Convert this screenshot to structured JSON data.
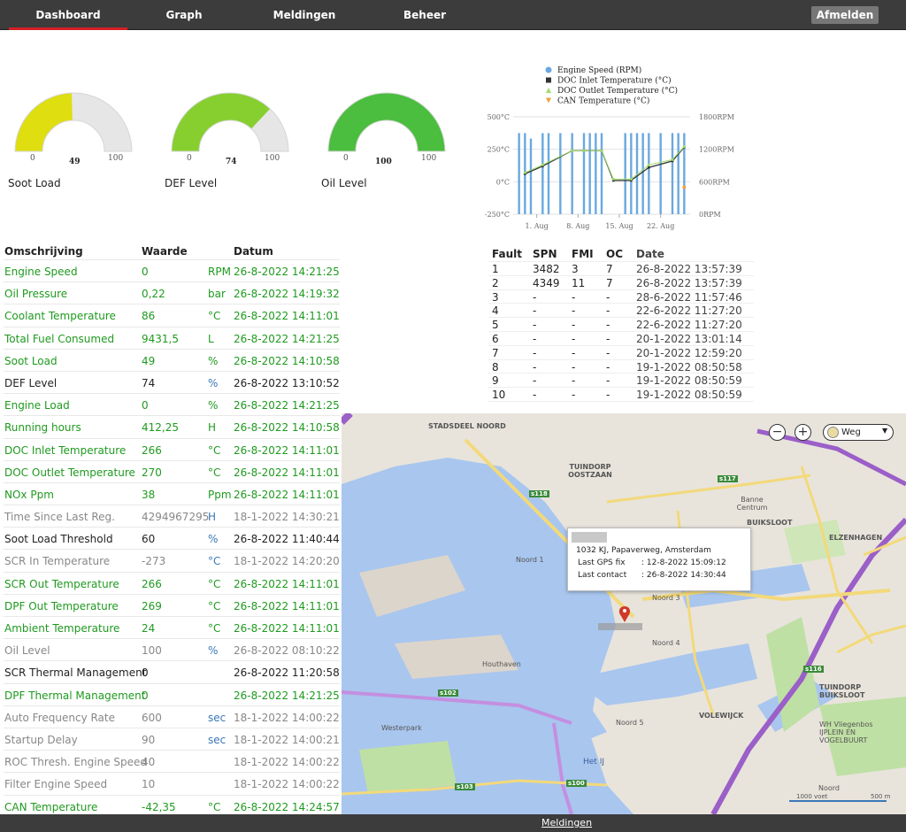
{
  "nav": {
    "tabs": [
      {
        "label": "Dashboard",
        "active": true
      },
      {
        "label": "Graph",
        "active": false
      },
      {
        "label": "Meldingen",
        "active": false
      },
      {
        "label": "Beheer",
        "active": false
      }
    ],
    "logout_label": "Afmelden"
  },
  "gauges": [
    {
      "label": "Soot Load",
      "value": 49,
      "min": 0,
      "max": 100,
      "color": "#dede10"
    },
    {
      "label": "DEF Level",
      "value": 74,
      "min": 0,
      "max": 100,
      "color": "#86cf2e"
    },
    {
      "label": "Oil Level",
      "value": 100,
      "min": 0,
      "max": 100,
      "color": "#4bbd3f"
    }
  ],
  "chart_data": {
    "type": "line",
    "legend": [
      "Engine Speed (RPM)",
      "DOC Inlet Temperature (°C)",
      "DOC Outlet Temperature (°C)",
      "CAN Temperature (°C)"
    ],
    "legend_colors": [
      "#6aa8e0",
      "#333333",
      "#9edc6a",
      "#f2a13a"
    ],
    "y_left_ticks": [
      "500°C",
      "250°C",
      "0°C",
      "-250°C"
    ],
    "y_right_ticks": [
      "1800RPM",
      "1200RPM",
      "600RPM",
      "0RPM"
    ],
    "x_ticks": [
      "1. Aug",
      "8. Aug",
      "15. Aug",
      "22. Aug"
    ],
    "ylim_left": [
      -250,
      500
    ],
    "ylim_right": [
      0,
      1800
    ],
    "series": [
      {
        "name": "Engine Speed (RPM)",
        "x": [
          "2022-07-29",
          "2022-07-30",
          "2022-07-31",
          "2022-08-02",
          "2022-08-03",
          "2022-08-05",
          "2022-08-07",
          "2022-08-09",
          "2022-08-10",
          "2022-08-11",
          "2022-08-12",
          "2022-08-16",
          "2022-08-17",
          "2022-08-18",
          "2022-08-19",
          "2022-08-20",
          "2022-08-22",
          "2022-08-24",
          "2022-08-25",
          "2022-08-26"
        ],
        "values": [
          1500,
          1500,
          1400,
          1500,
          1500,
          1500,
          1500,
          1500,
          1500,
          1500,
          1500,
          1500,
          1500,
          1500,
          1500,
          1500,
          1500,
          1500,
          1500,
          1500
        ]
      },
      {
        "name": "DOC Inlet Temperature (°C)",
        "x": [
          "2022-07-30",
          "2022-08-02",
          "2022-08-07",
          "2022-08-09",
          "2022-08-12",
          "2022-08-14",
          "2022-08-17",
          "2022-08-20",
          "2022-08-24",
          "2022-08-26"
        ],
        "values": [
          60,
          120,
          240,
          240,
          240,
          10,
          10,
          110,
          160,
          266
        ]
      },
      {
        "name": "DOC Outlet Temperature (°C)",
        "x": [
          "2022-07-30",
          "2022-08-02",
          "2022-08-07",
          "2022-08-09",
          "2022-08-12",
          "2022-08-14",
          "2022-08-17",
          "2022-08-20",
          "2022-08-24",
          "2022-08-26"
        ],
        "values": [
          70,
          130,
          240,
          240,
          240,
          20,
          20,
          130,
          170,
          270
        ]
      },
      {
        "name": "CAN Temperature (°C)",
        "x": [
          "2022-08-26"
        ],
        "values": [
          -42
        ]
      }
    ]
  },
  "status_table": {
    "headers": [
      "Omschrijving",
      "Waarde",
      "",
      "Datum"
    ],
    "rows": [
      {
        "name": "Engine Speed",
        "value": "0",
        "unit": "RPM",
        "date": "26-8-2022 14:21:25",
        "state": "green"
      },
      {
        "name": "Oil Pressure",
        "value": "0,22",
        "unit": "bar",
        "date": "26-8-2022 14:19:32",
        "state": "green"
      },
      {
        "name": "Coolant Temperature",
        "value": "86",
        "unit": "°C",
        "date": "26-8-2022 14:11:01",
        "state": "green"
      },
      {
        "name": "Total Fuel Consumed",
        "value": "9431,5",
        "unit": "L",
        "date": "26-8-2022 14:21:25",
        "state": "green"
      },
      {
        "name": "Soot Load",
        "value": "49",
        "unit": "%",
        "date": "26-8-2022 14:10:58",
        "state": "green"
      },
      {
        "name": "DEF Level",
        "value": "74",
        "unit": "%",
        "date": "26-8-2022 13:10:52",
        "state": "black"
      },
      {
        "name": "Engine Load",
        "value": "0",
        "unit": "%",
        "date": "26-8-2022 14:21:25",
        "state": "green"
      },
      {
        "name": "Running hours",
        "value": "412,25",
        "unit": "H",
        "date": "26-8-2022 14:10:58",
        "state": "green"
      },
      {
        "name": "DOC Inlet Temperature",
        "value": "266",
        "unit": "°C",
        "date": "26-8-2022 14:11:01",
        "state": "green"
      },
      {
        "name": "DOC Outlet Temperature",
        "value": "270",
        "unit": "°C",
        "date": "26-8-2022 14:11:01",
        "state": "green"
      },
      {
        "name": "NOx Ppm",
        "value": "38",
        "unit": "Ppm",
        "date": "26-8-2022 14:11:01",
        "state": "green"
      },
      {
        "name": "Time Since Last Reg.",
        "value": "4294967295",
        "unit": "H",
        "date": "18-1-2022 14:30:21",
        "state": "grey"
      },
      {
        "name": "Soot Load Threshold",
        "value": "60",
        "unit": "%",
        "date": "26-8-2022 11:40:44",
        "state": "black"
      },
      {
        "name": "SCR In Temperature",
        "value": "-273",
        "unit": "°C",
        "date": "18-1-2022 14:20:20",
        "state": "grey"
      },
      {
        "name": "SCR Out Temperature",
        "value": "266",
        "unit": "°C",
        "date": "26-8-2022 14:11:01",
        "state": "green"
      },
      {
        "name": "DPF Out Temperature",
        "value": "269",
        "unit": "°C",
        "date": "26-8-2022 14:11:01",
        "state": "green"
      },
      {
        "name": "Ambient Temperature",
        "value": "24",
        "unit": "°C",
        "date": "26-8-2022 14:11:01",
        "state": "green"
      },
      {
        "name": "Oil Level",
        "value": "100",
        "unit": "%",
        "date": "26-8-2022 08:10:22",
        "state": "grey"
      },
      {
        "name": "SCR Thermal Management",
        "value": "0",
        "unit": "",
        "date": "26-8-2022 11:20:58",
        "state": "black"
      },
      {
        "name": "DPF Thermal Management",
        "value": "0",
        "unit": "",
        "date": "26-8-2022 14:21:25",
        "state": "green"
      },
      {
        "name": "Auto Frequency Rate",
        "value": "600",
        "unit": "sec",
        "date": "18-1-2022 14:00:22",
        "state": "grey"
      },
      {
        "name": "Startup Delay",
        "value": "90",
        "unit": "sec",
        "date": "18-1-2022 14:00:21",
        "state": "grey"
      },
      {
        "name": "ROC Thresh. Engine Speed",
        "value": "40",
        "unit": "",
        "date": "18-1-2022 14:00:22",
        "state": "grey"
      },
      {
        "name": "Filter Engine Speed",
        "value": "10",
        "unit": "",
        "date": "18-1-2022 14:00:22",
        "state": "grey"
      },
      {
        "name": "CAN Temperature",
        "value": "-42,35",
        "unit": "°C",
        "date": "26-8-2022 14:24:57",
        "state": "green"
      }
    ]
  },
  "fault_table": {
    "headers": [
      "Fault",
      "SPN",
      "FMI",
      "OC",
      "Date"
    ],
    "rows": [
      [
        "1",
        "3482",
        "3",
        "7",
        "26-8-2022 13:57:39"
      ],
      [
        "2",
        "4349",
        "11",
        "7",
        "26-8-2022 13:57:39"
      ],
      [
        "3",
        "-",
        "-",
        "-",
        "28-6-2022 11:57:46"
      ],
      [
        "4",
        "-",
        "-",
        "-",
        "22-6-2022 11:27:20"
      ],
      [
        "5",
        "-",
        "-",
        "-",
        "22-6-2022 11:27:20"
      ],
      [
        "6",
        "-",
        "-",
        "-",
        "20-1-2022 13:01:14"
      ],
      [
        "7",
        "-",
        "-",
        "-",
        "20-1-2022 12:59:20"
      ],
      [
        "8",
        "-",
        "-",
        "-",
        "19-1-2022 08:50:58"
      ],
      [
        "9",
        "-",
        "-",
        "-",
        "19-1-2022 08:50:59"
      ],
      [
        "10",
        "-",
        "-",
        "-",
        "19-1-2022 08:50:59"
      ]
    ]
  },
  "map": {
    "map_type": "Weg",
    "zoom_out": "−",
    "zoom_in": "+",
    "popup": {
      "address": "1032 KJ, Papaverweg, Amsterdam",
      "gps_label": "Last GPS fix",
      "gps_value": ": 12-8-2022 15:09:12",
      "contact_label": "Last contact",
      "contact_value": ": 26-8-2022 14:30:44"
    },
    "labels": [
      "STADSDEEL NOORD",
      "TUINDORP OOSTZAAN",
      "BUIKSLOOT",
      "ELZENHAGEN",
      "Banne Centrum",
      "Noord 1",
      "Noord 3",
      "Noord 4",
      "Noord 5",
      "Houthaven",
      "Westerpark",
      "Het IJ",
      "VOLEWIJCK",
      "TUINDORP BUIKSLOOT",
      "WH Vliegenbos IJPLEIN EN VOGELBUURT",
      "Noord"
    ],
    "road_shields": [
      "s118",
      "s117",
      "s116",
      "s102",
      "s103",
      "s100"
    ],
    "scale": [
      "1000 voet",
      "500 m"
    ]
  },
  "footer": {
    "link": "Meldingen"
  }
}
